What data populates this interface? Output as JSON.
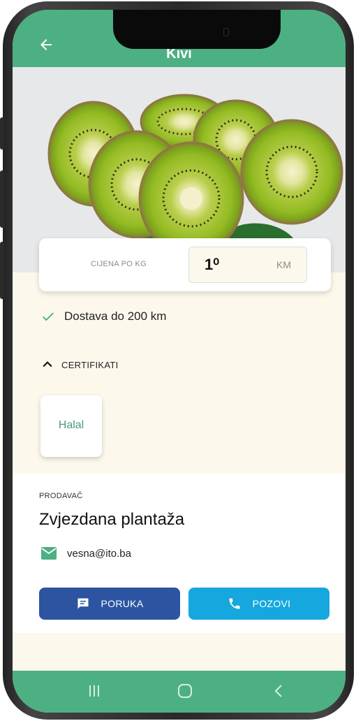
{
  "app_bar": {
    "title": "Kivi"
  },
  "product": {
    "image_icon": "kiwi-slices-image"
  },
  "price": {
    "label": "CIJENA PO KG",
    "value": "1⁰",
    "unit": "KM"
  },
  "delivery": {
    "text": "Dostava do 200 km",
    "icon": "check-icon"
  },
  "certificates": {
    "title": "CERTIFIKATI",
    "expanded": true,
    "items": [
      {
        "name": "Halal"
      }
    ]
  },
  "seller": {
    "label": "PRODAVAČ",
    "name": "Zvjezdana plantaža",
    "email": "vesna@ito.ba"
  },
  "actions": {
    "message_label": "PORUKA",
    "call_label": "POZOVI"
  },
  "colors": {
    "primary_green": "#4db083",
    "cream_background": "#fcf9ec",
    "message_button": "#2c54a1",
    "call_button": "#15a7de",
    "certificate_text": "#4a9a7c"
  }
}
